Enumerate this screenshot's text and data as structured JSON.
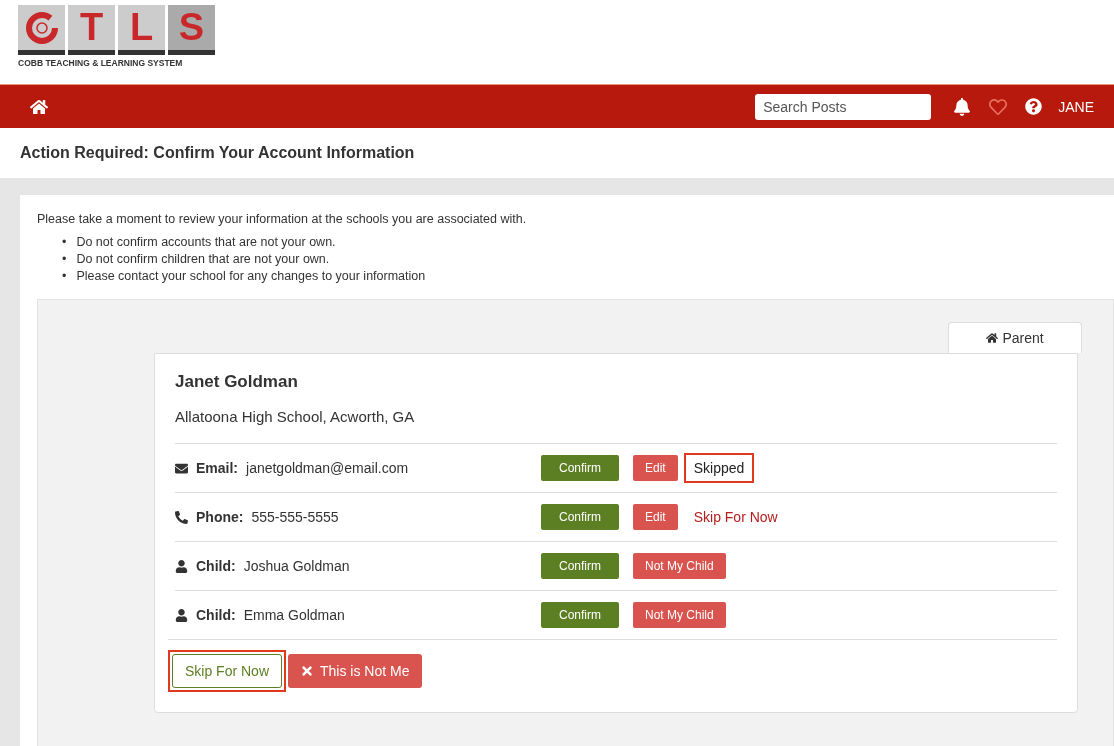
{
  "logo": {
    "letters": [
      "T",
      "L",
      "S"
    ],
    "tagline": "COBB TEACHING & LEARNING SYSTEM"
  },
  "navbar": {
    "search": {
      "placeholder": "Search Posts"
    },
    "user": "JANE"
  },
  "page_title": "Action Required: Confirm Your Account Information",
  "intro": "Please take a moment to review your information at the schools you are associated with.",
  "notes": [
    {
      "bullet": "•",
      "text": "Do not confirm accounts that are not your own."
    },
    {
      "bullet": "•",
      "text": "Do not confirm children that are not your own."
    },
    {
      "bullet": "•",
      "text": "Please contact your school for any changes to your information"
    }
  ],
  "tabs": [
    {
      "label": "Parent",
      "selected": true
    }
  ],
  "card": {
    "name": "Janet Goldman",
    "school": "Allatoona High School, Acworth, GA",
    "rows": [
      {
        "kind": "email",
        "label": "Email:",
        "value": "janetgoldman@email.com",
        "actions": [
          "Confirm",
          "Edit"
        ],
        "status": {
          "kind": "skipped",
          "text": "Skipped",
          "highlighted": true
        }
      },
      {
        "kind": "phone",
        "label": "Phone:",
        "value": "555-555-5555",
        "actions": [
          "Confirm",
          "Edit"
        ],
        "status": {
          "kind": "link",
          "text": "Skip For Now",
          "highlighted": false
        }
      },
      {
        "kind": "child",
        "label": "Child:",
        "value": "Joshua Goldman",
        "actions": [
          "Confirm",
          "Not My Child"
        ]
      },
      {
        "kind": "child",
        "label": "Child:",
        "value": "Emma Goldman",
        "actions": [
          "Confirm",
          "Not My Child"
        ]
      }
    ],
    "footer_buttons": [
      {
        "kind": "skip",
        "label": "Skip For Now",
        "highlighted": true
      },
      {
        "kind": "reject",
        "label": "This is Not Me",
        "highlighted": false
      }
    ]
  }
}
